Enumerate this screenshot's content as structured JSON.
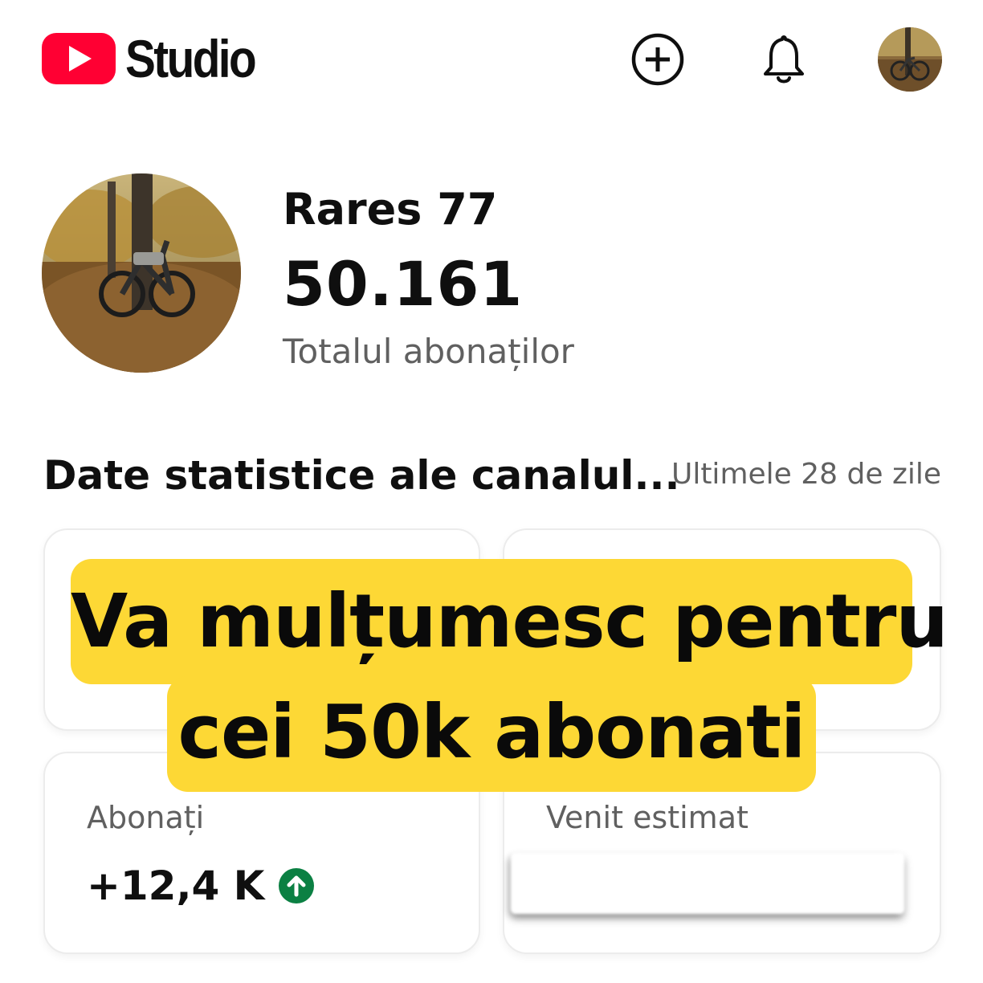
{
  "header": {
    "logo_text": "Studio",
    "icons": [
      "youtube-play-icon",
      "create-plus-icon",
      "bell-icon",
      "account-avatar"
    ]
  },
  "profile": {
    "channel_name": "Rares 77",
    "subscriber_total": "50.161",
    "subscriber_label": "Totalul abonaților"
  },
  "analytics": {
    "title": "Date statistice ale canalul...",
    "period": "Ultimele 28 de zile",
    "cards": [
      {
        "label": "Abonați",
        "value": "+12,4 K",
        "trend": "up"
      },
      {
        "label": "Venit estimat",
        "value": ""
      }
    ]
  },
  "overlay": {
    "line1": "Va mulțumesc pentru",
    "line2": "cei 50k abonati"
  },
  "colors": {
    "brand_red": "#ff0033",
    "banner_yellow": "#fdd835",
    "trend_green": "#0b8043",
    "secondary_text": "#606060"
  }
}
